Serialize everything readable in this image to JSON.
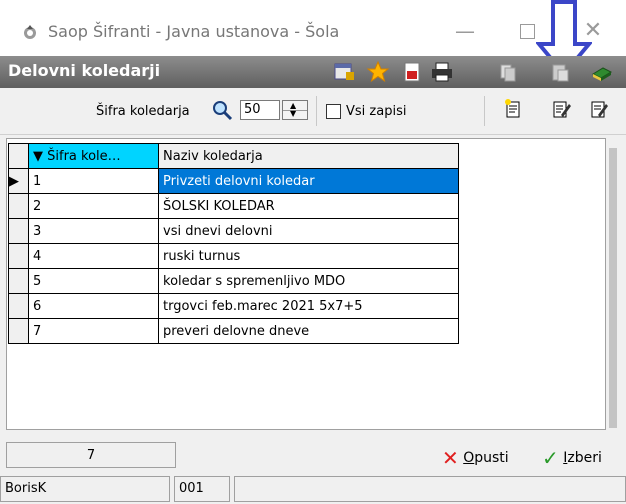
{
  "window": {
    "title": "Saop  Šifranti - Javna ustanova - Šola",
    "controls": {
      "minimize": "—",
      "close": "✕"
    }
  },
  "header": {
    "title": "Delovni koledarji"
  },
  "toolbar": {
    "sifra_label": "Šifra koledarja",
    "sifra_value": "50",
    "vsi_zapisi_label": "Vsi zapisi"
  },
  "grid": {
    "columns": [
      "Šifra kole…",
      "Naziv koledarja"
    ],
    "rows": [
      {
        "sifra": "1",
        "naziv": "Privzeti delovni koledar"
      },
      {
        "sifra": "2",
        "naziv": "ŠOLSKI KOLEDAR"
      },
      {
        "sifra": "3",
        "naziv": "vsi dnevi delovni"
      },
      {
        "sifra": "4",
        "naziv": "ruski turnus"
      },
      {
        "sifra": "5",
        "naziv": "koledar s spremenljivo MDO"
      },
      {
        "sifra": "6",
        "naziv": "trgovci feb.marec 2021   5x7+5"
      },
      {
        "sifra": "7",
        "naziv": "preveri delovne dneve"
      }
    ]
  },
  "footer": {
    "count": "7",
    "opusti_first": "O",
    "opusti_rest": "pusti",
    "izberi_first": "I",
    "izberi_rest": "zberi"
  },
  "statusbar": {
    "user": "BorisK",
    "code": "001"
  },
  "colors": {
    "selection": "#0078d7",
    "sort_header": "#00d4ff",
    "arrow": "#3b46c8"
  }
}
